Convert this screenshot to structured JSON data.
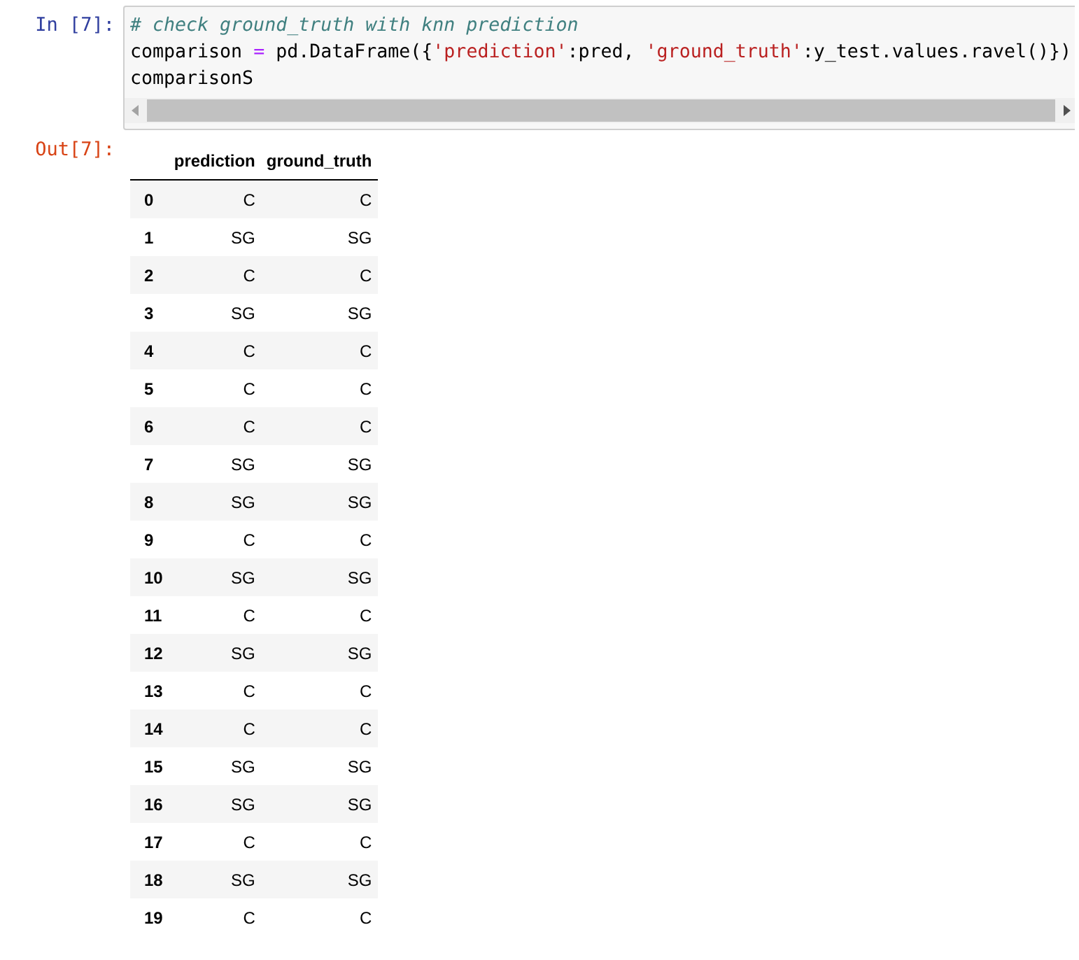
{
  "input_cell": {
    "prompt": "In [7]:",
    "lines": [
      [
        {
          "kind": "comment",
          "text": "# check ground_truth with knn prediction"
        }
      ],
      [
        {
          "kind": "plain",
          "text": "comparison "
        },
        {
          "kind": "operator",
          "text": "="
        },
        {
          "kind": "plain",
          "text": " pd.DataFrame({"
        },
        {
          "kind": "string",
          "text": "'prediction'"
        },
        {
          "kind": "plain",
          "text": ":pred, "
        },
        {
          "kind": "string",
          "text": "'ground_truth'"
        },
        {
          "kind": "plain",
          "text": ":y_test.values.ravel()})"
        }
      ],
      [
        {
          "kind": "plain",
          "text": "comparisonS"
        }
      ]
    ]
  },
  "output_cell": {
    "prompt": "Out[7]:",
    "table": {
      "columns": [
        "prediction",
        "ground_truth"
      ],
      "rows": [
        {
          "index": "0",
          "values": [
            "C",
            "C"
          ]
        },
        {
          "index": "1",
          "values": [
            "SG",
            "SG"
          ]
        },
        {
          "index": "2",
          "values": [
            "C",
            "C"
          ]
        },
        {
          "index": "3",
          "values": [
            "SG",
            "SG"
          ]
        },
        {
          "index": "4",
          "values": [
            "C",
            "C"
          ]
        },
        {
          "index": "5",
          "values": [
            "C",
            "C"
          ]
        },
        {
          "index": "6",
          "values": [
            "C",
            "C"
          ]
        },
        {
          "index": "7",
          "values": [
            "SG",
            "SG"
          ]
        },
        {
          "index": "8",
          "values": [
            "SG",
            "SG"
          ]
        },
        {
          "index": "9",
          "values": [
            "C",
            "C"
          ]
        },
        {
          "index": "10",
          "values": [
            "SG",
            "SG"
          ]
        },
        {
          "index": "11",
          "values": [
            "C",
            "C"
          ]
        },
        {
          "index": "12",
          "values": [
            "SG",
            "SG"
          ]
        },
        {
          "index": "13",
          "values": [
            "C",
            "C"
          ]
        },
        {
          "index": "14",
          "values": [
            "C",
            "C"
          ]
        },
        {
          "index": "15",
          "values": [
            "SG",
            "SG"
          ]
        },
        {
          "index": "16",
          "values": [
            "SG",
            "SG"
          ]
        },
        {
          "index": "17",
          "values": [
            "C",
            "C"
          ]
        },
        {
          "index": "18",
          "values": [
            "SG",
            "SG"
          ]
        },
        {
          "index": "19",
          "values": [
            "C",
            "C"
          ]
        }
      ]
    }
  }
}
